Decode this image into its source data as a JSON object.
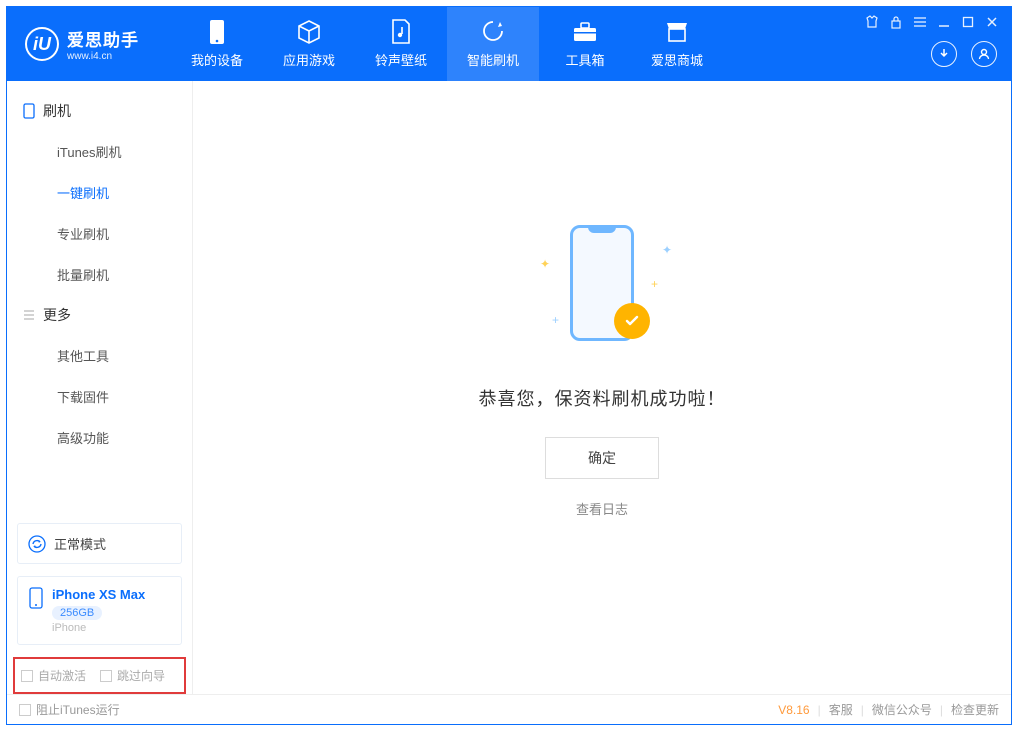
{
  "brand": {
    "title": "爱思助手",
    "subtitle": "www.i4.cn",
    "logo_letter": "iU"
  },
  "nav": {
    "tabs": [
      {
        "label": "我的设备"
      },
      {
        "label": "应用游戏"
      },
      {
        "label": "铃声壁纸"
      },
      {
        "label": "智能刷机"
      },
      {
        "label": "工具箱"
      },
      {
        "label": "爱思商城"
      }
    ]
  },
  "sidebar": {
    "group1_title": "刷机",
    "items1": [
      {
        "label": "iTunes刷机"
      },
      {
        "label": "一键刷机"
      },
      {
        "label": "专业刷机"
      },
      {
        "label": "批量刷机"
      }
    ],
    "group2_title": "更多",
    "items2": [
      {
        "label": "其他工具"
      },
      {
        "label": "下载固件"
      },
      {
        "label": "高级功能"
      }
    ],
    "mode_label": "正常模式",
    "device": {
      "name": "iPhone XS Max",
      "capacity": "256GB",
      "type": "iPhone"
    },
    "options": {
      "auto_activate": "自动激活",
      "skip_guide": "跳过向导"
    }
  },
  "main": {
    "message": "恭喜您，保资料刷机成功啦！",
    "ok_label": "确定",
    "view_log": "查看日志"
  },
  "footer": {
    "block_itunes": "阻止iTunes运行",
    "version": "V8.16",
    "links": [
      "客服",
      "微信公众号",
      "检查更新"
    ]
  }
}
